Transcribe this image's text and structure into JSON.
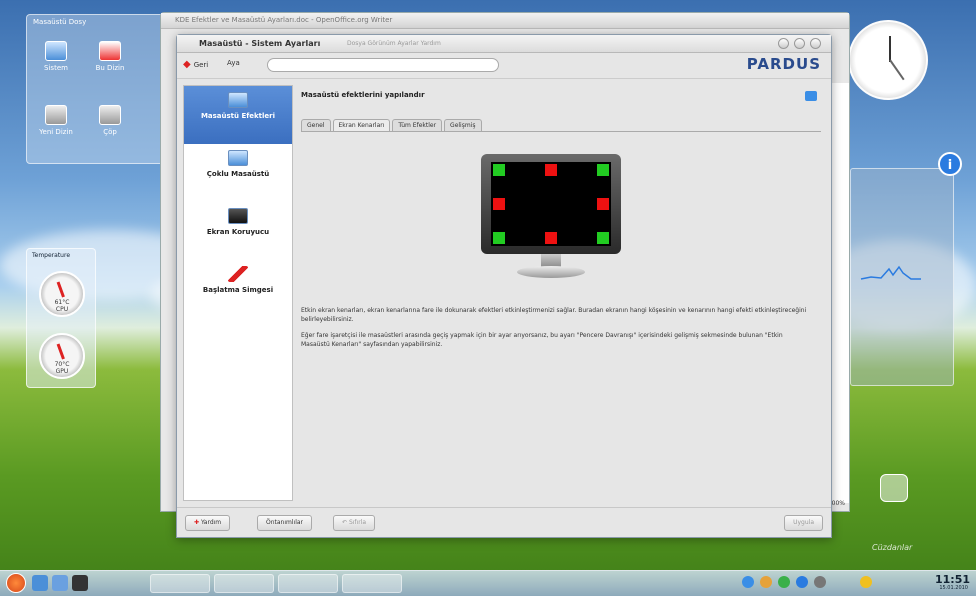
{
  "desktop": {
    "folderview_title": "Masaüstü Dosy",
    "icons": [
      {
        "label": "Sistem"
      },
      {
        "label": "Bu Dizin"
      },
      {
        "label": "Yeni Dizin"
      },
      {
        "label": "Çöp"
      }
    ],
    "temp_widget_title": "Temperature",
    "gauges": [
      {
        "value": "61°C",
        "label": "CPU"
      },
      {
        "value": "70°C",
        "label": "GPU"
      }
    ],
    "watermark": "Cüzdanlar"
  },
  "background_window": {
    "title": "KDE Efektler ve Masaüstü Ayarları.doc - OpenOffice.org Writer",
    "zoom": "100%"
  },
  "dialog": {
    "title": "Masaüstü - Sistem Ayarları",
    "menu_hint": "Dosya Görünüm Ayarlar Yardım",
    "toolbar": {
      "back_label": "Geri",
      "help_label": "Aya"
    },
    "logo": "PARDUS",
    "sidebar": [
      {
        "label": "Masaüstü Efektleri",
        "icon": "desktop-effects-icon",
        "active": true
      },
      {
        "label": "Çoklu Masaüstü",
        "icon": "multiple-desktops-icon",
        "active": false
      },
      {
        "label": "Ekran Koruyucu",
        "icon": "screensaver-icon",
        "active": false
      },
      {
        "label": "Başlatma Simgesi",
        "icon": "launch-feedback-icon",
        "active": false
      }
    ],
    "content": {
      "heading": "Masaüstü efektlerini yapılandır",
      "tabs": [
        {
          "label": "Genel",
          "active": false
        },
        {
          "label": "Ekran Kenarları",
          "active": true
        },
        {
          "label": "Tüm Efektler",
          "active": false
        },
        {
          "label": "Gelişmiş",
          "active": false
        }
      ],
      "desc1": "Etkin ekran kenarları, ekran kenarlarına fare ile dokunarak efektleri etkinleştirmenizi sağlar. Buradan ekranın hangi köşesinin ve kenarının hangi efekti etkinleştireceğini belirleyebilirsiniz.",
      "desc2": "Eğer fare işaretçisi ile masaüstleri arasında geçiş yapmak için bir ayar arıyorsanız, bu ayarı \"Pencere Davranışı\" içerisindeki gelişmiş sekmesinde bulunan \"Etkin Masaüstü Kenarları\" sayfasından yapabilirsiniz."
    },
    "buttons": {
      "help": "Yardım",
      "defaults": "Öntanımlılar",
      "reset": "Sıfırla",
      "apply": "Uygula"
    }
  },
  "panel": {
    "clock": "11:51",
    "date": "15.01.2010"
  },
  "colors": {
    "edge_active": "#22cc22",
    "edge_inactive": "#ee1111",
    "selection": "#3b6fc0"
  }
}
